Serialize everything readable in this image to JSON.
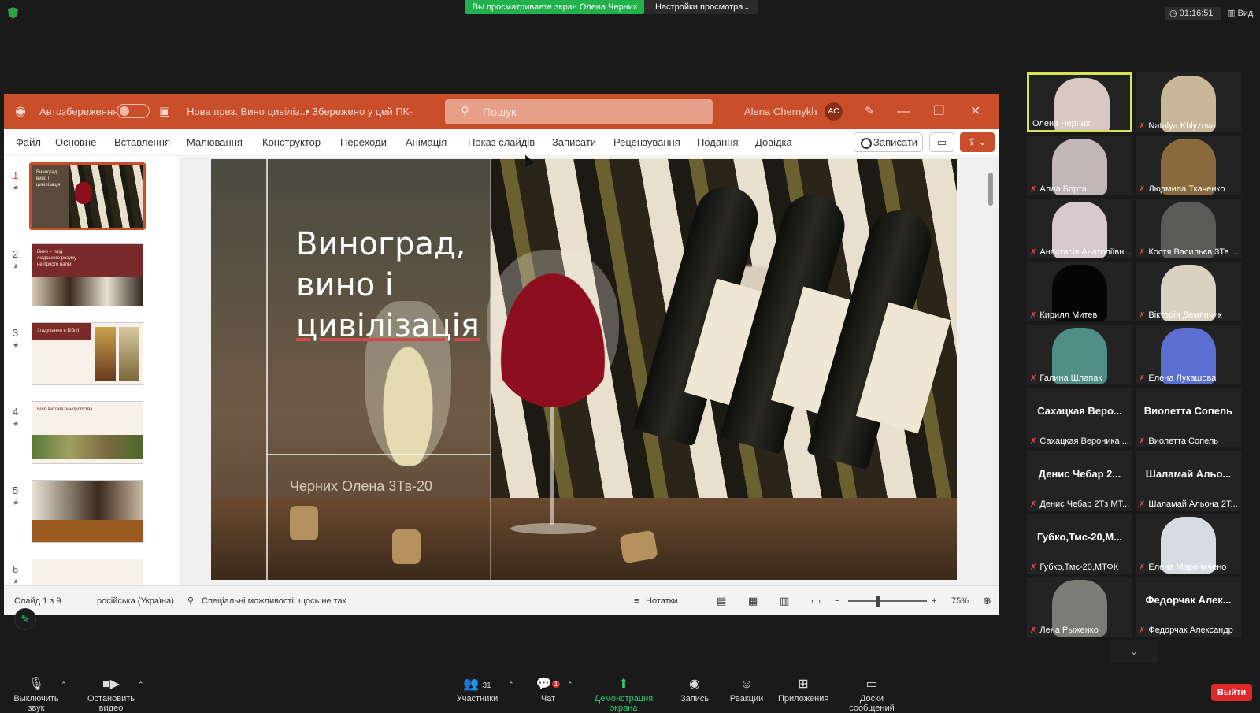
{
  "zoom": {
    "share_banner": "Вы просматриваете экран Олена Черних",
    "view_settings": "Настройки просмотра",
    "timer": "01:16:51",
    "view_label": "Вид",
    "leave": "Выйти",
    "toolbar": {
      "mute": "Выключить звук",
      "stop_video": "Остановить видео",
      "participants": "Участники",
      "participants_count": "31",
      "chat": "Чат",
      "chat_badge": "1",
      "share": "Демонстрация экрана",
      "record": "Запись",
      "reactions": "Реакции",
      "apps": "Приложения",
      "whiteboards": "Доски сообщений"
    }
  },
  "ppt": {
    "autosave": "Автозбереження",
    "doc_title": "Нова през. Вино цивіліз...",
    "saved": "• Збережено у цей ПК",
    "search_placeholder": "Пошук",
    "user": "Alena Chernykh",
    "user_initials": "AC",
    "tabs": [
      "Файл",
      "Основне",
      "Вставлення",
      "Малювання",
      "Конструктор",
      "Переходи",
      "Анімація",
      "Показ слайдів",
      "Записати",
      "Рецензування",
      "Подання",
      "Довідка"
    ],
    "record_btn": "Записати",
    "slides": [
      {
        "num": "1",
        "text": "Виноград, вино і цивілізація"
      },
      {
        "num": "2",
        "text": "Вино – плід людського розуму – не просто напій."
      },
      {
        "num": "3",
        "text": "Згадування в Біблії"
      },
      {
        "num": "4",
        "text": "Біля витоків виноробства"
      },
      {
        "num": "5",
        "text": ""
      },
      {
        "num": "6",
        "text": ""
      }
    ],
    "slide": {
      "title_line1": "Виноград,",
      "title_line2": "вино і",
      "title_line3": "цивілізація",
      "subtitle": "Черних Олена 3Тв-20"
    },
    "status": {
      "slide_count": "Слайд 1 з 9",
      "language": "російська (Україна)",
      "accessibility": "Спеціальні можливості: щось не так",
      "notes": "Нотатки",
      "zoom": "75%"
    }
  },
  "participants": [
    {
      "name": "Олена Черних",
      "type": "video",
      "active": true,
      "color": "#d9c8c2"
    },
    {
      "name": "Natalya Khlyzova",
      "type": "video",
      "color": "#c9b79a"
    },
    {
      "name": "Алла Борта",
      "type": "video",
      "color": "#c2b6b8"
    },
    {
      "name": "Людмила Ткаченко",
      "type": "video",
      "color": "#8a6a3c"
    },
    {
      "name": "Анастасія Анатоліївн...",
      "type": "video",
      "color": "#d7c9cd"
    },
    {
      "name": "Костя Васильєв 3Тв ...",
      "type": "video",
      "color": "#5a5a58"
    },
    {
      "name": "Кирилл Митев",
      "type": "video",
      "color": "#050505"
    },
    {
      "name": "Вікторія Демянчик",
      "type": "video",
      "color": "#d9d2c0"
    },
    {
      "name": "Галина Шлапак",
      "type": "video",
      "color": "#4f8f86"
    },
    {
      "name": "Елена Лукашова",
      "type": "video",
      "color": "#5a6fd0"
    },
    {
      "name": "Сахацкая Вероника ...",
      "type": "name",
      "big": "Сахацкая  Веро..."
    },
    {
      "name": "Виолетта Сопель",
      "type": "name",
      "big": "Виолетта Сопель"
    },
    {
      "name": "Денис Чебар 2Тз МТ...",
      "type": "name",
      "big": "Денис Чебар 2..."
    },
    {
      "name": "Шаламай Альона 2Т...",
      "type": "name",
      "big": "Шаламай  Альо..."
    },
    {
      "name": "Губко,Тмс-20,МТФК",
      "type": "name",
      "big": "Губко,Тмс-20,М..."
    },
    {
      "name": "Елена Мареничено",
      "type": "video",
      "color": "#d6dbe4"
    },
    {
      "name": "Лена Рыженко",
      "type": "video",
      "color": "#7b7b78"
    },
    {
      "name": "Федорчак Александр",
      "type": "name",
      "big": "Федорчак  Алек..."
    }
  ]
}
